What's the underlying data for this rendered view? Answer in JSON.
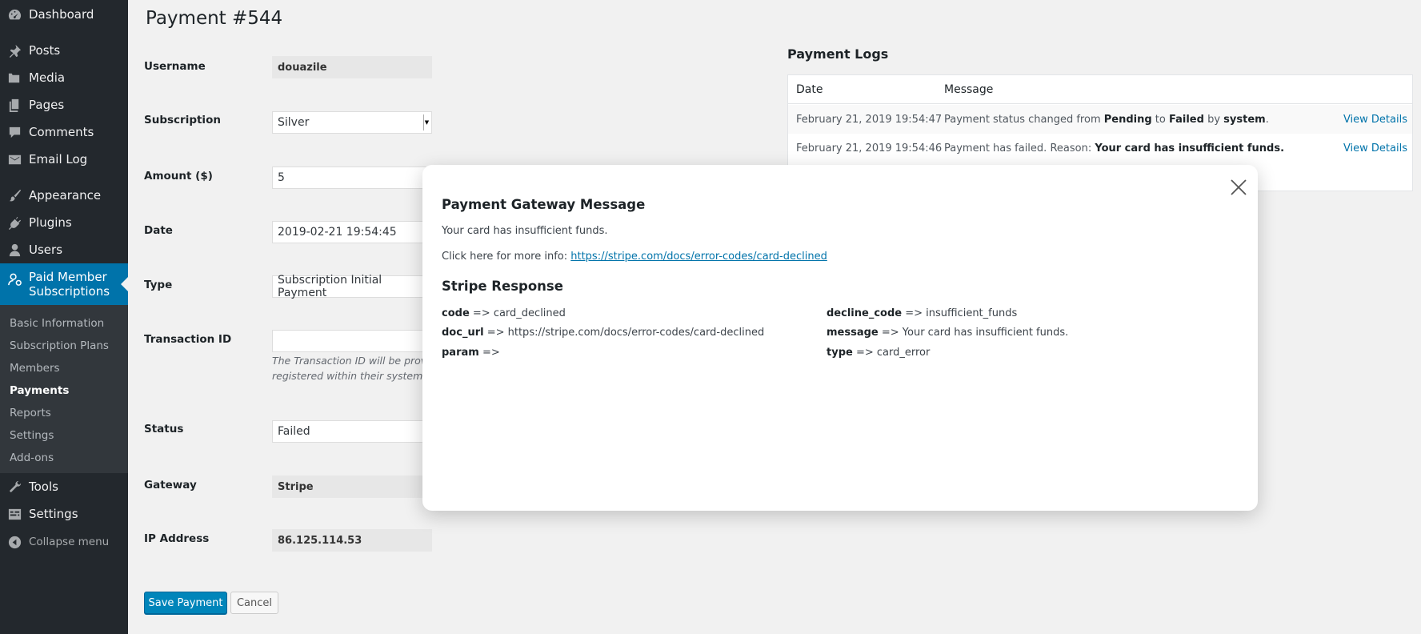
{
  "sidebar": {
    "items": [
      {
        "label": "Dashboard",
        "icon": "dashboard-icon"
      },
      {
        "label": "Posts",
        "icon": "pin-icon"
      },
      {
        "label": "Media",
        "icon": "media-icon"
      },
      {
        "label": "Pages",
        "icon": "pages-icon"
      },
      {
        "label": "Comments",
        "icon": "comment-icon"
      },
      {
        "label": "Email Log",
        "icon": "email-icon"
      },
      {
        "label": "Appearance",
        "icon": "brush-icon"
      },
      {
        "label": "Plugins",
        "icon": "plugin-icon"
      },
      {
        "label": "Users",
        "icon": "user-icon"
      }
    ],
    "active": {
      "label_line1": "Paid Member",
      "label_line2": "Subscriptions",
      "icon": "members-icon"
    },
    "submenu": [
      "Basic Information",
      "Subscription Plans",
      "Members",
      "Payments",
      "Reports",
      "Settings",
      "Add-ons"
    ],
    "bottom_items": [
      {
        "label": "Tools",
        "icon": "wrench-icon"
      },
      {
        "label": "Settings",
        "icon": "settings-icon"
      }
    ],
    "collapse": "Collapse menu"
  },
  "page": {
    "title": "Payment #544",
    "fields": {
      "username_label": "Username",
      "username_value": "douazile",
      "subscription_label": "Subscription",
      "subscription_value": "Silver",
      "amount_label": "Amount ($)",
      "amount_value": "5",
      "date_label": "Date",
      "date_value": "2019-02-21 19:54:45",
      "type_label": "Type",
      "type_value": "Subscription Initial Payment",
      "transaction_label": "Transaction ID",
      "transaction_value": "",
      "transaction_desc": "The Transaction ID will be provic registered within their system.",
      "status_label": "Status",
      "status_value": "Failed",
      "gateway_label": "Gateway",
      "gateway_value": "Stripe",
      "ip_label": "IP Address",
      "ip_value": "86.125.114.53"
    },
    "save_button": "Save Payment",
    "cancel_button": "Cancel"
  },
  "logs": {
    "title": "Payment Logs",
    "col_date": "Date",
    "col_message": "Message",
    "rows": [
      {
        "date": "February 21, 2019 19:54:47",
        "msg_a": "Payment status changed from ",
        "msg_b": "Pending",
        "msg_c": " to ",
        "msg_d": "Failed",
        "msg_e": " by ",
        "msg_f": "system",
        "msg_g": ".",
        "link": "View Details"
      },
      {
        "date": "February 21, 2019 19:54:46",
        "msg_a": "Payment has failed. Reason: ",
        "msg_b": "Your card has insufficient funds.",
        "link": "View Details"
      }
    ]
  },
  "modal": {
    "title": "Payment Gateway Message",
    "message": "Your card has insufficient funds.",
    "more_info_prefix": "Click here for more info: ",
    "more_info_link": "https://stripe.com/docs/error-codes/card-declined",
    "response_title": "Stripe Response",
    "response": {
      "code_key": "code",
      "code_val": " => card_declined",
      "doc_url_key": "doc_url",
      "doc_url_val": " => https://stripe.com/docs/error-codes/card-declined",
      "param_key": "param",
      "param_val": " =>",
      "decline_code_key": "decline_code",
      "decline_code_val": " => insufficient_funds",
      "message_key": "message",
      "message_val": " => Your card has insufficient funds.",
      "type_key": "type",
      "type_val": " => card_error"
    }
  },
  "colors": {
    "accent": "#0073aa",
    "sidebar": "#23282d",
    "submenu": "#32373c",
    "button": "#0085ba"
  }
}
